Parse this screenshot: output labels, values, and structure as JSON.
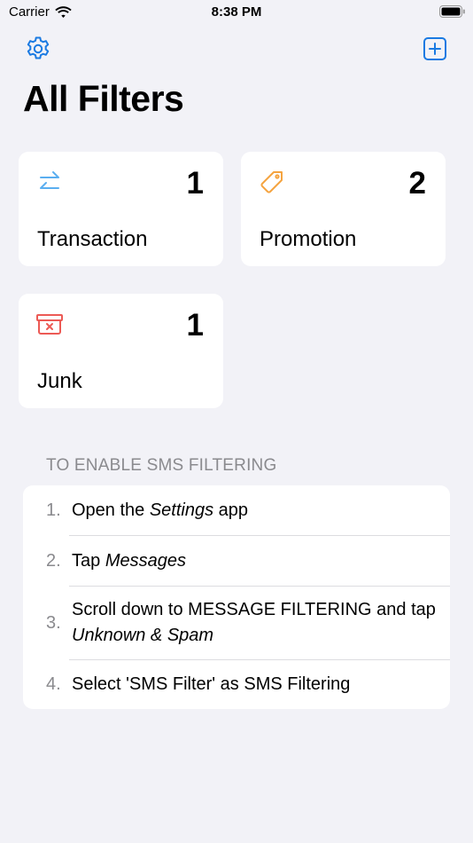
{
  "status_bar": {
    "carrier": "Carrier",
    "time": "8:38 PM"
  },
  "nav": {
    "settings_icon": "gear-icon",
    "add_icon": "plus-square-icon",
    "accent": "#1a7ae2"
  },
  "title": "All Filters",
  "cards": [
    {
      "label": "Transaction",
      "count": "1",
      "icon": "arrows-exchange-icon",
      "color": "#5aaef0"
    },
    {
      "label": "Promotion",
      "count": "2",
      "icon": "tag-icon",
      "color": "#f5a440"
    },
    {
      "label": "Junk",
      "count": "1",
      "icon": "junk-box-icon",
      "color": "#ec5a55"
    }
  ],
  "instructions": {
    "header": "TO ENABLE SMS FILTERING",
    "steps": [
      {
        "num": "1.",
        "parts": [
          "Open the ",
          "Settings",
          " app"
        ]
      },
      {
        "num": "2.",
        "parts": [
          "Tap ",
          "Messages"
        ]
      },
      {
        "num": "3.",
        "parts": [
          "Scroll down to MESSAGE FILTERING and tap ",
          "Unknown & Spam"
        ]
      },
      {
        "num": "4.",
        "parts": [
          "Select 'SMS Filter' as SMS Filtering"
        ]
      }
    ]
  }
}
